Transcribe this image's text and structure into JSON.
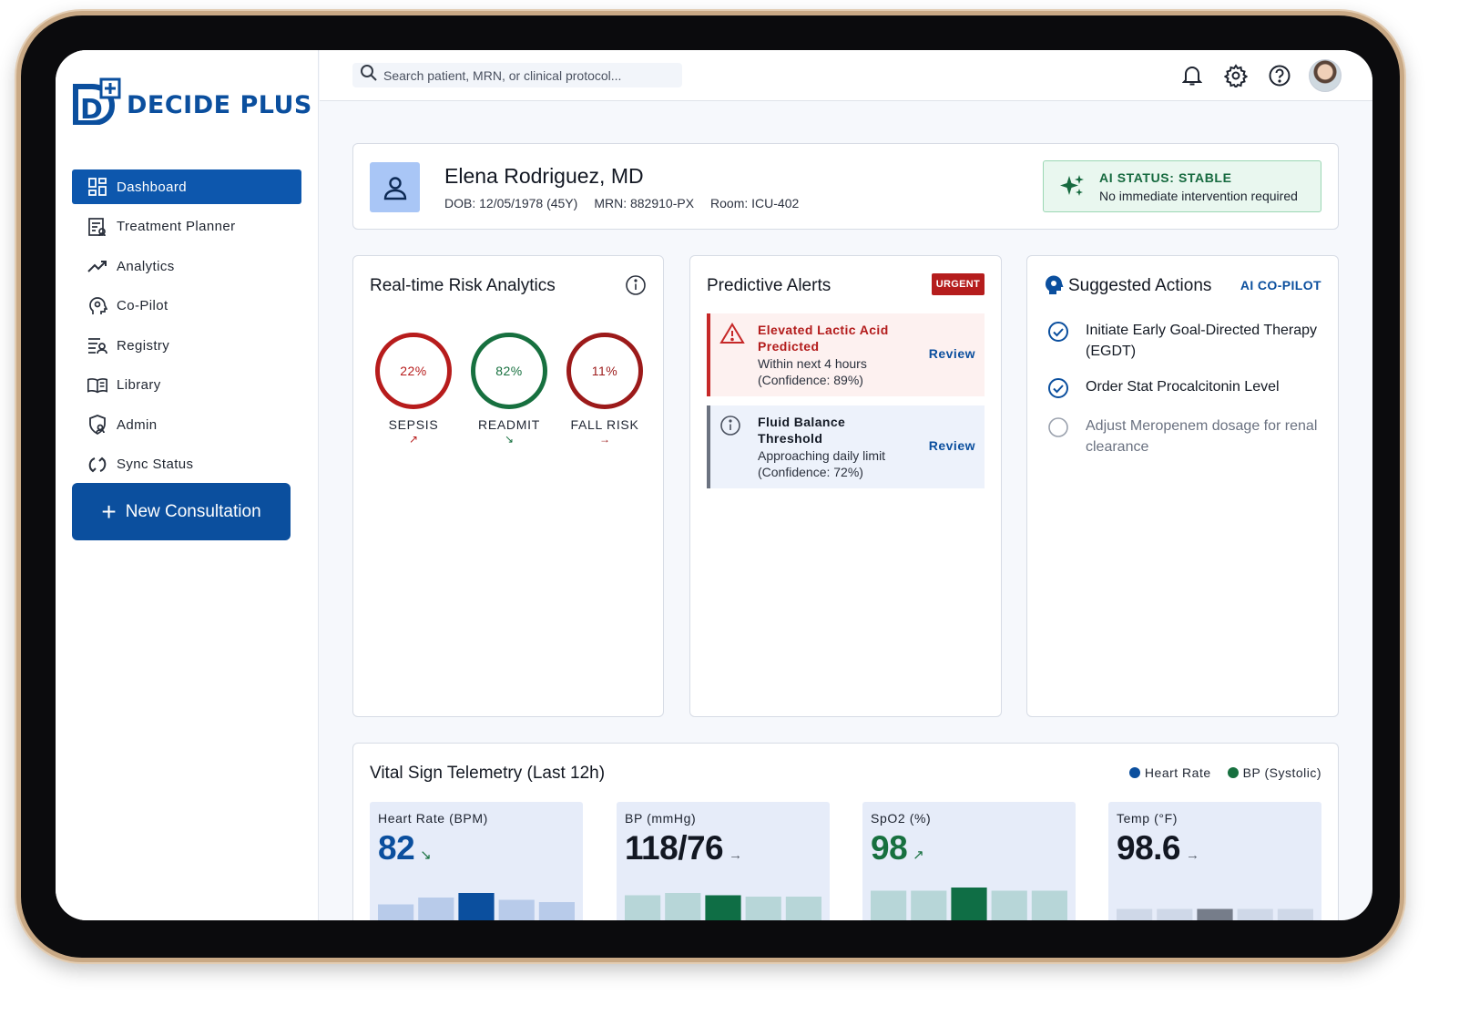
{
  "brand": {
    "name": "DECIDE PLUS",
    "mark": "D",
    "color": "#0b4f9e"
  },
  "sidebar": {
    "items": [
      {
        "label": "Dashboard",
        "icon": "dashboard-icon",
        "active": true
      },
      {
        "label": "Treatment Planner",
        "icon": "planner-icon",
        "active": false
      },
      {
        "label": "Analytics",
        "icon": "analytics-icon",
        "active": false
      },
      {
        "label": "Co-Pilot",
        "icon": "copilot-icon",
        "active": false
      },
      {
        "label": "Registry",
        "icon": "registry-icon",
        "active": false
      },
      {
        "label": "Library",
        "icon": "library-icon",
        "active": false
      },
      {
        "label": "Admin",
        "icon": "admin-icon",
        "active": false
      },
      {
        "label": "Sync Status",
        "icon": "sync-icon",
        "active": false
      }
    ],
    "cta_label": "New Consultation"
  },
  "topbar": {
    "search_placeholder": "Search patient, MRN, or clinical protocol...",
    "icons": [
      "bell-icon",
      "gear-icon",
      "help-icon",
      "avatar"
    ]
  },
  "patient": {
    "name": "Elena Rodriguez, MD",
    "dob": "DOB: 12/05/1978 (45Y)",
    "mrn": "MRN: 882910-PX",
    "room": "Room: ICU-402",
    "ai_status_title": "AI STATUS: STABLE",
    "ai_status_sub": "No immediate intervention required"
  },
  "risk": {
    "title": "Real-time Risk Analytics",
    "gauges": [
      {
        "value": "22%",
        "label": "SEPSIS",
        "trend": "↗",
        "color": "#b71c1c"
      },
      {
        "value": "82%",
        "label": "READMIT",
        "trend": "↘",
        "color": "#17703f"
      },
      {
        "value": "11%",
        "label": "FALL RISK",
        "trend": "→",
        "color": "#9c1a1a"
      }
    ]
  },
  "alerts": {
    "title": "Predictive Alerts",
    "badge": "URGENT",
    "items": [
      {
        "title": "Elevated Lactic Acid Predicted",
        "line1": "Within next 4 hours",
        "line2": "(Confidence: 89%)",
        "action": "Review",
        "icon": "warning-icon"
      },
      {
        "title": "Fluid Balance Threshold",
        "line1": "Approaching daily limit",
        "line2": "(Confidence: 72%)",
        "action": "Review",
        "icon": "info-icon"
      }
    ]
  },
  "actions": {
    "title": "Suggested Actions",
    "tag": "AI CO-PILOT",
    "items": [
      {
        "text": "Initiate Early Goal-Directed Therapy (EGDT)",
        "done": true
      },
      {
        "text": "Order Stat Procalcitonin Level",
        "done": true
      },
      {
        "text": "Adjust Meropenem dosage for renal clearance",
        "done": false
      }
    ]
  },
  "vitals": {
    "title": "Vital Sign Telemetry (Last 12h)",
    "legend": [
      {
        "label": "Heart Rate",
        "color": "#0b4f9e"
      },
      {
        "label": "BP (Systolic)",
        "color": "#17703f"
      }
    ],
    "cards": [
      {
        "label": "Heart Rate (BPM)",
        "value": "82",
        "trend": "↘",
        "trend_color": "#17703f",
        "value_color": "#0b4f9e",
        "bar_color": "#b8cbea",
        "highlight_color": "#0b4f9e",
        "bars": [
          0.55,
          0.7,
          0.8,
          0.65,
          0.6
        ],
        "highlight": 2
      },
      {
        "label": "BP (mmHg)",
        "value": "118/76",
        "trend": "→",
        "trend_color": "#555c68",
        "value_color": "#121722",
        "bar_color": "#b7d6d8",
        "highlight_color": "#0f6e45",
        "bars": [
          0.75,
          0.8,
          0.75,
          0.72,
          0.72
        ],
        "highlight": 2
      },
      {
        "label": "SpO2 (%)",
        "value": "98",
        "trend": "↗",
        "trend_color": "#17703f",
        "value_color": "#17703f",
        "bar_color": "#b7d6d8",
        "highlight_color": "#0f6e45",
        "bars": [
          0.85,
          0.85,
          0.92,
          0.85,
          0.85
        ],
        "highlight": 2
      },
      {
        "label": "Temp (°F)",
        "value": "98.6",
        "trend": "→",
        "trend_color": "#555c68",
        "value_color": "#121722",
        "bar_color": "#cfd8e8",
        "highlight_color": "#767d8a",
        "bars": [
          0.45,
          0.45,
          0.45,
          0.45,
          0.45
        ],
        "highlight": 2
      }
    ]
  }
}
